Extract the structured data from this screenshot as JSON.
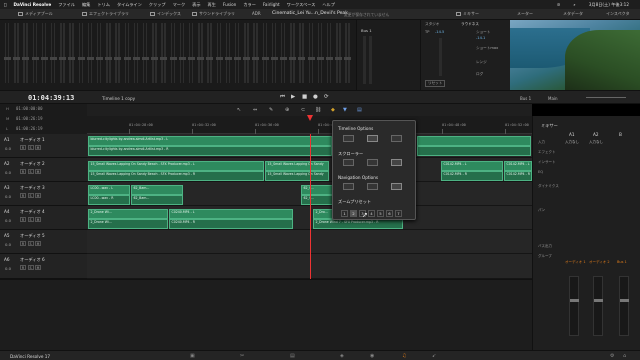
{
  "menubar": {
    "app": "DaVinci Resolve",
    "items": [
      "ファイル",
      "編集",
      "トリム",
      "タイムライン",
      "クリップ",
      "マーク",
      "表示",
      "再生",
      "Fusion",
      "カラー",
      "Fairlight",
      "ワークスペース",
      "ヘルプ"
    ],
    "clock": "3月8日(土) 午後3:12"
  },
  "toolbar": {
    "media_pool": "メディアプール",
    "effects": "エフェクトライブラリ",
    "index": "インデックス",
    "sound_library": "サウンドライブラリ",
    "adr": "ADR",
    "project": "Cinematic_Lei Yu...n_Devil's Peak",
    "edited": "変更が保存されていません",
    "mixer": "ミキサー",
    "meters": "メーター",
    "metadata": "メタデータ",
    "inspector": "インスペクタ"
  },
  "loudness": {
    "title": "ラウドネス",
    "bus": "Bus 1",
    "studio": "スタジオ",
    "tp": "TP",
    "tp_val": "-14.5",
    "short": "ショート",
    "short_val": "-14.1",
    "short_max": "ショートmax",
    "range": "レンジ",
    "integrated": "ログ",
    "reset": "リセット"
  },
  "timecode": {
    "current": "01:04:39:13",
    "timeline": "Timeline 1 copy",
    "bus": "Bus 1",
    "main": "Main"
  },
  "markers": [
    {
      "letter": "H",
      "tc": "01:00:00:00"
    },
    {
      "letter": "M",
      "tc": "01:00:26:19"
    },
    {
      "letter": "L",
      "tc": "01:00:26:19"
    }
  ],
  "ruler": [
    "01:04:28:00",
    "01:04:32:00",
    "01:04:36:00",
    "01:04:40:00",
    "01:04:48:00",
    "01:04:52:00"
  ],
  "tracks": [
    {
      "id": "A1",
      "name": "オーディオ 1",
      "vol": "0.0"
    },
    {
      "id": "A2",
      "name": "オーディオ 2",
      "vol": "0.0"
    },
    {
      "id": "A3",
      "name": "オーディオ 3",
      "vol": "0.0"
    },
    {
      "id": "A4",
      "name": "オーディオ 4",
      "vol": "0.0"
    },
    {
      "id": "A5",
      "name": "オーディオ 5",
      "vol": "0.0"
    },
    {
      "id": "A6",
      "name": "オーディオ 6",
      "vol": "0.0"
    }
  ],
  "clips": {
    "a1_1": "blurred-citylights by-andrea-simdi-Artlist.mp3 - L",
    "a1_2": "blurred-citylights by-andrea-simdi-Artlist.mp3 - R",
    "a2_1": "15_Small Waves Lapping On Sandy Beach - SFX Producer.mp3 - L",
    "a2_2": "15_Small Waves Lapping On Sandy Beach - SFX Producer.mp3 - R",
    "a2_3": "15_Small Waves Lapping On Sandy",
    "a2_4": "15_Small Waves Lapping On Sandy",
    "a2_5": "C0142.MP4 - L",
    "a2_6": "C0142.MP4 - R",
    "a2_7": "C0142.MP4 - L",
    "a2_8": "C0142.MP4 - R",
    "a3_1": "LC00...wav - L",
    "a3_2": "LC00...wav - R",
    "a3_3": "62_Bam...",
    "a3_4": "62_Bam...",
    "a3_5": "62_S...",
    "a3_6": "62_S...",
    "a4_1": "2_Drone Wi...",
    "a4_2": "C0240.MP4 - L",
    "a4_3": "2_Drone Wi...",
    "a4_4": "C0240.MP4 - R",
    "a4_5": "2_Dro...",
    "a4_6": "2_Drone Wind 7 - SFX Producer.mp3 - R"
  },
  "popup": {
    "timeline_options": "Timeline Options",
    "scroller": "スクローラー",
    "navigation_options": "Navigation Options",
    "zoom_presets": "ズームプリセット",
    "zoom": [
      "1",
      "2",
      "3",
      "4",
      "5",
      "6",
      "7"
    ]
  },
  "mixer": {
    "title": "ミキサー",
    "ch1": "A1",
    "ch2": "A2",
    "bus1": "B",
    "input": "入力",
    "input_none": "入力なし",
    "effects": "エフェクト",
    "insert": "インサート",
    "eq": "EQ",
    "dynamics": "ダイナミクス",
    "pan": "パン",
    "bus_out": "バス出力",
    "group": "グループ",
    "ch1_name": "オーディオ 1",
    "ch2_name": "オーディオ 2",
    "bus_name": "Bus 1"
  },
  "pagebar": {
    "brand": "DaVinci Resolve 17"
  }
}
